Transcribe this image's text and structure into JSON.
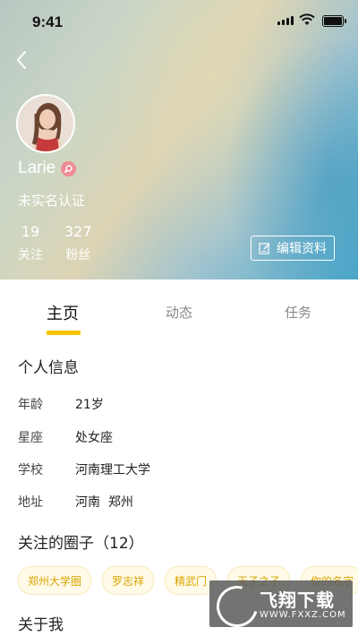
{
  "status_bar": {
    "time": "9:41"
  },
  "profile": {
    "name": "Larie",
    "verification": "未实名认证",
    "stats": [
      {
        "value": "19",
        "label": "关注"
      },
      {
        "value": "327",
        "label": "粉丝"
      }
    ],
    "edit_button": "编辑资料"
  },
  "tabs": [
    {
      "label": "主页",
      "active": true
    },
    {
      "label": "动态",
      "active": false
    },
    {
      "label": "任务",
      "active": false
    }
  ],
  "personal_info": {
    "title": "个人信息",
    "rows": [
      {
        "key": "年龄",
        "value": "21岁"
      },
      {
        "key": "星座",
        "value": "处女座"
      },
      {
        "key": "学校",
        "value": "河南理工大学"
      },
      {
        "key": "地址",
        "value": "河南  郑州"
      }
    ]
  },
  "circles": {
    "title": "关注的圈子（12）",
    "items": [
      "郑州大学圈",
      "罗志祥",
      "精武门",
      "天子之子",
      "你的名字"
    ]
  },
  "about": {
    "title": "关于我"
  },
  "watermark": {
    "text": "飞翔下载",
    "url": "WWW.FXXZ.COM"
  },
  "colors": {
    "accent": "#f5c400",
    "chip_text": "#d9a400",
    "badge": "#f08a93"
  }
}
